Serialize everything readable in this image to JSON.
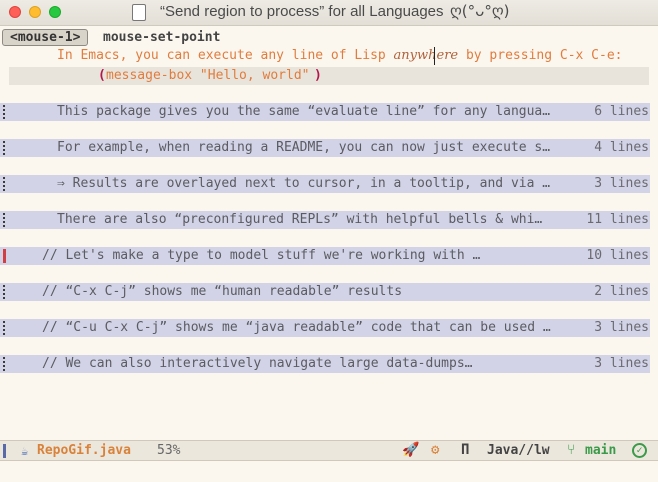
{
  "window": {
    "title": "“Send region to process” for all Languages",
    "title_face": "ღ(°ᴗ°ღ)"
  },
  "echo": {
    "key": "<mouse-1>",
    "command": "mouse-set-point"
  },
  "intro": {
    "before": "In Emacs, you can execute any line of Lisp ",
    "emphasis": "anywhere",
    "after": " by pressing C-x C-e:",
    "code_open": "(",
    "code_body": "message-box \"Hello, world\"",
    "code_close": ")"
  },
  "folds": [
    {
      "text": "This package gives you the same “evaluate line” for any langua…",
      "count": "6 lines"
    },
    {
      "text": "For example, when reading a README, you can now just execute s…",
      "count": "4 lines"
    },
    {
      "text": "⇒ Results are overlayed next to cursor, in a tooltip, and via …",
      "count": "3 lines"
    },
    {
      "text": "There are also “preconfigured REPLs” with helpful bells & whi…",
      "count": "11 lines"
    },
    {
      "text": "// Let's make a type to model stuff we're working with …",
      "count": "10 lines"
    },
    {
      "text": "// “C-x C-j” shows me “human readable” results",
      "count": "2 lines"
    },
    {
      "text": "// “C-u C-x C-j” shows me “java readable” code that can be used …",
      "count": "3 lines"
    },
    {
      "text": "// We can also interactively navigate large data-dumps…",
      "count": "3 lines"
    }
  ],
  "modeline": {
    "file_icon": "☕",
    "filename": "RepoGif.java",
    "percent": "53%",
    "rocket_icon": "🚀",
    "gear_icon": "⚙",
    "pi_icon": "Π",
    "mode": "Java//lw",
    "branch_icon": "⑂",
    "branch": "main",
    "check_icon": "✓"
  }
}
